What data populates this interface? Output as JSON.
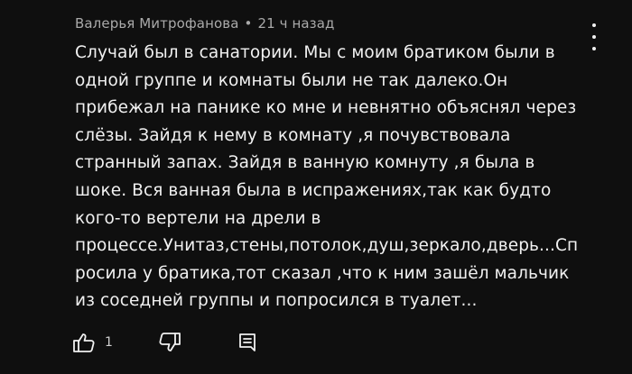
{
  "comment": {
    "author": "Валерья Митрофанова",
    "separator": "•",
    "time": "21 ч назад",
    "text_lines": [
      "Случай был в санатории. Мы с моим братиком были в",
      "одной группе и комнаты были не так далеко.Он",
      "прибежал на панике ко мне и невнятно объяснял через",
      "слёзы. Зайдя к нему в комнату ,я почувствовала",
      "странный запах. Зайдя в ванную комнуту ,я была в",
      "шоке. Вся ванная была в испражениях,так как будто",
      "кого-то вертели на дрели в",
      "процессе.Унитаз,стены,потолок,душ,зеркало,дверь...Сп",
      "росила у братика,тот сказал ,что к ним зашёл мальчик",
      "из соседней группы и попросился в туалет..."
    ],
    "like_count": "1",
    "icons": {
      "menu": "more-vertical-icon",
      "like": "thumbs-up-icon",
      "dislike": "thumbs-down-icon",
      "reply": "reply-icon"
    }
  },
  "colors": {
    "background": "#0f0f0f",
    "text": "#f1f1f1",
    "meta": "#aaaaaa"
  }
}
